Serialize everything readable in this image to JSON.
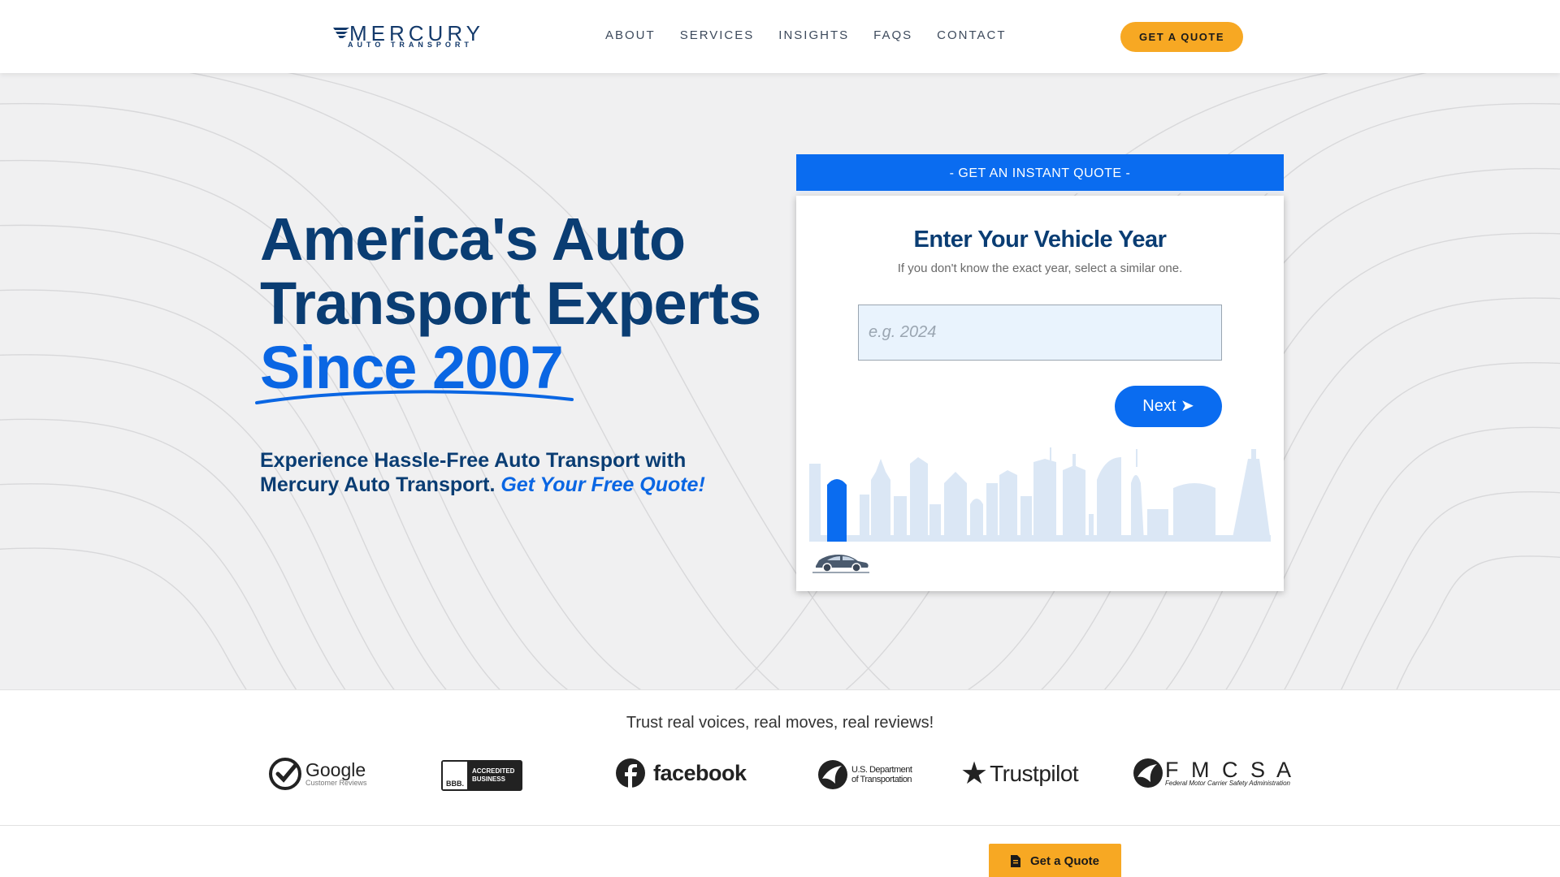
{
  "header": {
    "logo_title": "MERCURY",
    "logo_subtitle": "AUTO TRANSPORT",
    "nav": [
      {
        "label": "ABOUT"
      },
      {
        "label": "SERVICES"
      },
      {
        "label": "INSIGHTS"
      },
      {
        "label": "FAQS"
      },
      {
        "label": "CONTACT"
      }
    ],
    "cta_label": "GET A QUOTE"
  },
  "hero": {
    "title_line1": "America's Auto",
    "title_line2": "Transport Experts",
    "title_line3": "Since 2007",
    "subtitle": "Experience Hassle-Free Auto Transport with Mercury Auto Transport.",
    "subtitle_link": "Get Your Free Quote!"
  },
  "quote": {
    "banner": "- GET AN INSTANT QUOTE -",
    "title": "Enter Your Vehicle Year",
    "hint": "If you don't know the exact year, select a similar one.",
    "year_placeholder": "e.g. 2024",
    "year_value": "",
    "next_label": "Next ➤"
  },
  "trust": {
    "heading": "Trust real voices, real moves, real reviews!",
    "badges": {
      "google": {
        "name": "Google",
        "sub": "Customer Reviews"
      },
      "bbb": {
        "mark": "BBB.",
        "line1": "ACCREDITED",
        "line2": "BUSINESS"
      },
      "facebook": {
        "name": "facebook"
      },
      "usdot": {
        "line1": "U.S. Department",
        "line2": "of Transportation"
      },
      "trustpilot": {
        "name": "Trustpilot"
      },
      "fmcsa": {
        "name": "F M C S A",
        "sub": "Federal Motor Carrier Safety Administration"
      }
    }
  },
  "bottom_bar": {
    "cta_label": "Get a Quote"
  },
  "colors": {
    "brand_navy": "#0a3d73",
    "brand_blue": "#0a6cf0",
    "accent_orange": "#f7a823",
    "hero_bg": "#f0f0f1"
  }
}
